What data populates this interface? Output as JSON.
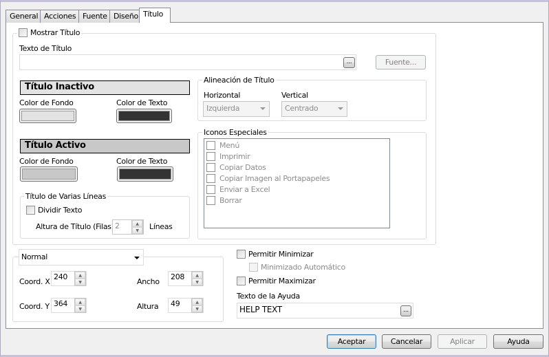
{
  "tabs": [
    "General",
    "Acciones",
    "Fuente",
    "Diseño",
    "Título"
  ],
  "mostrar_titulo": "Mostrar Título",
  "texto_titulo_label": "Texto de Título",
  "texto_titulo_value": "",
  "ellipsis": "...",
  "fuente_button": "Fuente...",
  "inactivo": {
    "title": "Título Inactivo",
    "fondo_label": "Color de Fondo",
    "texto_label": "Color de Texto",
    "fondo_color": "#e3e3e3",
    "texto_color": "#333333"
  },
  "activo": {
    "title": "Título Activo",
    "fondo_label": "Color de Fondo",
    "texto_label": "Color de Texto",
    "fondo_color": "#c8c8c8",
    "texto_color": "#333333"
  },
  "alineacion": {
    "legend": "Alineación de Título",
    "horizontal_label": "Horizontal",
    "horizontal_value": "Izquierda",
    "vertical_label": "Vertical",
    "vertical_value": "Centrado"
  },
  "iconos": {
    "legend": "Iconos Especiales",
    "items": [
      "Menú",
      "Imprimir",
      "Copiar Datos",
      "Copiar Imagen al Portapapeles",
      "Enviar a Excel",
      "Borrar"
    ]
  },
  "varias_lineas": {
    "legend": "Título de Varias Líneas",
    "dividir": "Dividir Texto",
    "altura_label": "Altura de Título (Filas)",
    "altura_value": "2",
    "lineas": "Líneas"
  },
  "pos": {
    "mode": "Normal",
    "x_label": "Coord. X",
    "x": "240",
    "y_label": "Coord. Y",
    "y": "364",
    "ancho_label": "Ancho",
    "ancho": "208",
    "altura_label": "Altura",
    "altura": "49"
  },
  "permitir_minimizar": "Permitir Minimizar",
  "minimizado_auto": "Minimizado Automático",
  "permitir_maximizar": "Permitir Maximizar",
  "ayuda_label": "Texto de la Ayuda",
  "ayuda_value": "HELP TEXT",
  "buttons": {
    "aceptar": "Aceptar",
    "cancelar": "Cancelar",
    "aplicar": "Aplicar",
    "ayuda": "Ayuda"
  }
}
